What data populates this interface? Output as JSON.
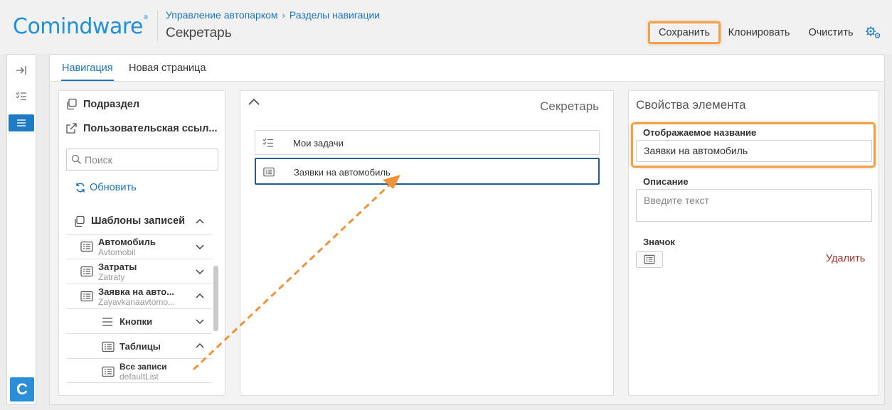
{
  "header": {
    "logo_text": "Comindware",
    "logo_mark": "®",
    "breadcrumb": [
      "Управление автопарком",
      "Разделы навигации"
    ],
    "page_title": "Секретарь",
    "buttons": {
      "save": "Сохранить",
      "clone": "Клонировать",
      "clear": "Очистить"
    }
  },
  "tabs": [
    {
      "label": "Навигация",
      "active": true
    },
    {
      "label": "Новая страница",
      "active": false
    }
  ],
  "toolbox": {
    "add_subsection": "Подраздел",
    "add_custom_link": "Пользовательская ссыл...",
    "search_placeholder": "Поиск",
    "refresh": "Обновить",
    "tree": [
      {
        "name": "Шаблоны записей",
        "sys": "",
        "level": 0,
        "expanded": true
      },
      {
        "name": "Автомобиль",
        "sys": "Avtomobil",
        "level": 1,
        "expanded": false
      },
      {
        "name": "Затраты",
        "sys": "Zatraty",
        "level": 1,
        "expanded": false
      },
      {
        "name": "Заявка на авто...",
        "sys": "Zayavkanaavtomo...",
        "level": 1,
        "expanded": true
      },
      {
        "name": "Кнопки",
        "sys": "",
        "level": 2,
        "expanded": false
      },
      {
        "name": "Таблицы",
        "sys": "",
        "level": 2,
        "expanded": true
      },
      {
        "name": "Все записи",
        "sys": "defaultList",
        "level": 3,
        "expanded": null
      }
    ]
  },
  "navigation": {
    "title": "Секретарь",
    "items": [
      {
        "label": "Мои задачи",
        "icon": "tasks-icon",
        "selected": false
      },
      {
        "label": "Заявки на автомобиль",
        "icon": "list-icon",
        "selected": true
      }
    ]
  },
  "properties": {
    "title": "Свойства элемента",
    "display_name_label": "Отображаемое название",
    "display_name_value": "Заявки на автомобиль",
    "description_label": "Описание",
    "description_placeholder": "Введите текст",
    "icon_label": "Значок",
    "delete_label": "Удалить"
  },
  "colors": {
    "accent": "#1e74b8",
    "highlight": "#f0a04b",
    "delete": "#a8322e"
  }
}
